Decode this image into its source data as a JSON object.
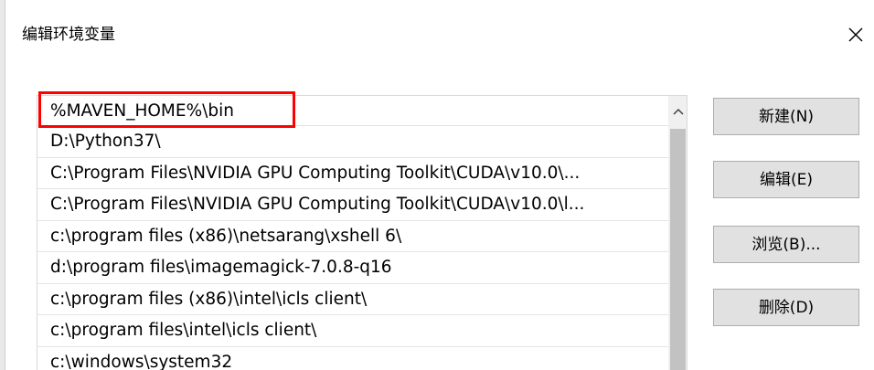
{
  "window": {
    "title": "编辑环境变量",
    "close_icon": "close-icon"
  },
  "path_list": {
    "items": [
      "%MAVEN_HOME%\\bin",
      "D:\\Python37\\",
      "C:\\Program Files\\NVIDIA GPU Computing Toolkit\\CUDA\\v10.0\\...",
      "C:\\Program Files\\NVIDIA GPU Computing Toolkit\\CUDA\\v10.0\\l...",
      "c:\\program files (x86)\\netsarang\\xshell 6\\",
      "d:\\program files\\imagemagick-7.0.8-q16",
      "c:\\program files (x86)\\intel\\icls client\\",
      "c:\\program files\\intel\\icls client\\",
      "c:\\windows\\system32"
    ],
    "highlighted_index": 0,
    "highlight_color": "#ff0000",
    "scroll_up_icon": "chevron-up-icon"
  },
  "buttons": {
    "new_label": "新建(N)",
    "edit_label": "编辑(E)",
    "browse_label": "浏览(B)...",
    "delete_label": "删除(D)"
  }
}
